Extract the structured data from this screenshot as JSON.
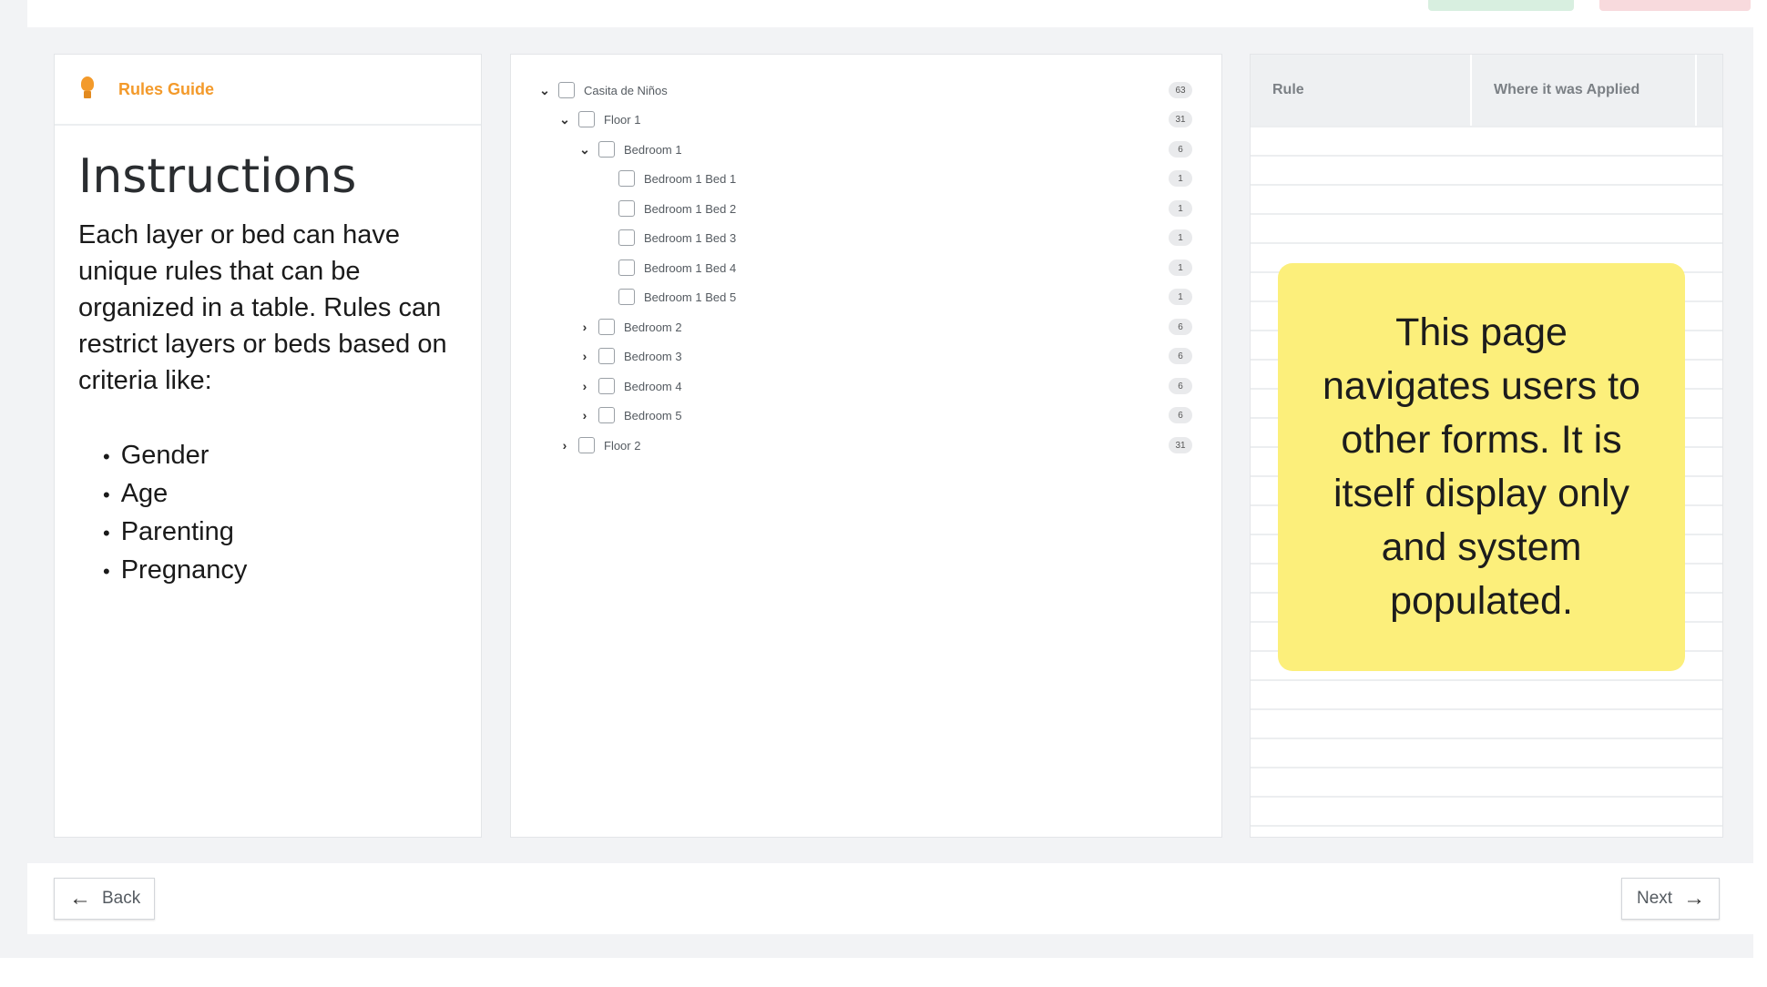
{
  "guide": {
    "header_title": "Rules Guide",
    "header_icon": "lightbulb-icon",
    "instructions_title": "Instructions",
    "instructions_text": "Each layer or bed can have unique rules that can be organized in a table. Rules can restrict layers or beds based on criteria like:",
    "criteria": [
      "Gender",
      "Age",
      "Parenting",
      "Pregnancy"
    ]
  },
  "tree": {
    "nodes": [
      {
        "label": "Casita de Niños",
        "count": "63",
        "state": "expanded"
      },
      {
        "label": "Floor 1",
        "count": "31",
        "state": "expanded"
      },
      {
        "label": "Bedroom 1",
        "count": "6",
        "state": "expanded"
      },
      {
        "label": "Bedroom 1 Bed 1",
        "count": "1",
        "state": "leaf"
      },
      {
        "label": "Bedroom 1 Bed 2",
        "count": "1",
        "state": "leaf"
      },
      {
        "label": "Bedroom 1 Bed 3",
        "count": "1",
        "state": "leaf"
      },
      {
        "label": "Bedroom 1 Bed 4",
        "count": "1",
        "state": "leaf"
      },
      {
        "label": "Bedroom 1 Bed 5",
        "count": "1",
        "state": "leaf"
      },
      {
        "label": "Bedroom 2",
        "count": "6",
        "state": "collapsed"
      },
      {
        "label": "Bedroom 3",
        "count": "6",
        "state": "collapsed"
      },
      {
        "label": "Bedroom 4",
        "count": "6",
        "state": "collapsed"
      },
      {
        "label": "Bedroom 5",
        "count": "6",
        "state": "collapsed"
      },
      {
        "label": "Floor 2",
        "count": "31",
        "state": "collapsed"
      }
    ]
  },
  "rules_table": {
    "columns": [
      "Rule",
      "Where it was Applied"
    ]
  },
  "sticky_note": {
    "text": "This page navigates users to other forms. It is itself display only and system populated."
  },
  "footer": {
    "back_label": "Back",
    "next_label": "Next"
  },
  "colors": {
    "accent": "#f39a2b",
    "sticky": "#fcef7b"
  }
}
